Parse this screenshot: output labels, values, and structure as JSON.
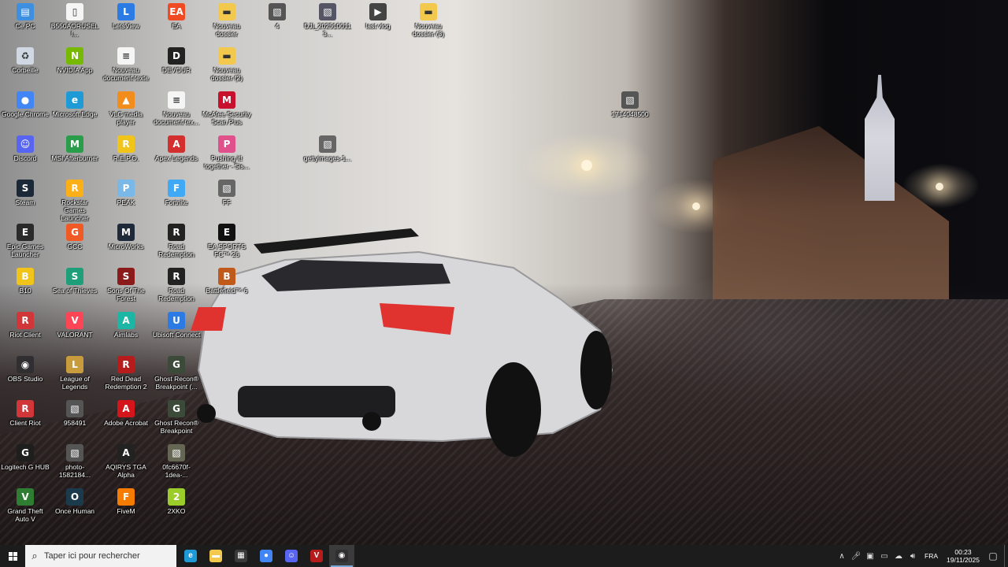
{
  "desktop": {
    "icons": [
      {
        "label": "Ce PC",
        "icon": "computer-icon",
        "color": "#3d8fe0"
      },
      {
        "label": "B550AORUSELI...",
        "icon": "document-icon",
        "color": "#f5f5f5"
      },
      {
        "label": "LetsView",
        "icon": "letsview-icon",
        "color": "#2c7be5"
      },
      {
        "label": "EA",
        "icon": "ea-icon",
        "color": "#f04a23"
      },
      {
        "label": "Nouveau dossier",
        "icon": "folder-icon",
        "color": "#f2c94c"
      },
      {
        "label": "4",
        "icon": "image-icon",
        "color": "#555"
      },
      {
        "label": "DJI_2025100113...",
        "icon": "image-icon",
        "color": "#556"
      },
      {
        "label": "last vlog",
        "icon": "video-icon",
        "color": "#444"
      },
      {
        "label": "Nouveau dossier (3)",
        "icon": "folder-icon",
        "color": "#f2c94c"
      },
      {
        "label": "Corbeille",
        "icon": "recycle-bin-icon",
        "color": "#cfd8e3"
      },
      {
        "label": "NVIDIA App",
        "icon": "nvidia-icon",
        "color": "#76b900"
      },
      {
        "label": "Nouveau document texte",
        "icon": "text-file-icon",
        "color": "#f5f5f5"
      },
      {
        "label": "DEVOUR",
        "icon": "devour-icon",
        "color": "#222"
      },
      {
        "label": "Nouveau dossier (2)",
        "icon": "folder-icon",
        "color": "#f2c94c"
      },
      {
        "label": "Google Chrome",
        "icon": "chrome-icon",
        "color": "#4285f4"
      },
      {
        "label": "Microsoft Edge",
        "icon": "edge-icon",
        "color": "#1e9bd7"
      },
      {
        "label": "VLC media player",
        "icon": "vlc-icon",
        "color": "#f28c1a"
      },
      {
        "label": "Nouveau document tex...",
        "icon": "text-file-icon",
        "color": "#f5f5f5"
      },
      {
        "label": "McAfee Security Scan Plus",
        "icon": "mcafee-icon",
        "color": "#c8102e"
      },
      {
        "label": "1714048500",
        "icon": "image-icon",
        "color": "#555"
      },
      {
        "label": "Discord",
        "icon": "discord-icon",
        "color": "#5865f2"
      },
      {
        "label": "MSI Afterburner",
        "icon": "msi-afterburner-icon",
        "color": "#2a9d4a"
      },
      {
        "label": "R.E.P.O.",
        "icon": "repo-icon",
        "color": "#f0c419"
      },
      {
        "label": "Apex Legends",
        "icon": "apex-icon",
        "color": "#d32f2f"
      },
      {
        "label": "Pushing it! together - Sis...",
        "icon": "app-icon",
        "color": "#e0508a"
      },
      {
        "label": "gettyimages-1...",
        "icon": "image-icon",
        "color": "#666"
      },
      {
        "label": "Steam",
        "icon": "steam-icon",
        "color": "#1b2838"
      },
      {
        "label": "Rockstar Games Launcher",
        "icon": "rockstar-icon",
        "color": "#fcaf17"
      },
      {
        "label": "PEAK",
        "icon": "peak-icon",
        "color": "#7ab8e8"
      },
      {
        "label": "Fortnite",
        "icon": "fortnite-icon",
        "color": "#3fa9f5"
      },
      {
        "label": "FF",
        "icon": "image-icon",
        "color": "#666"
      },
      {
        "label": "Epic Games Launcher",
        "icon": "epic-icon",
        "color": "#2a2a2a"
      },
      {
        "label": "GCC",
        "icon": "gcc-icon",
        "color": "#f15a24"
      },
      {
        "label": "MicroWorks",
        "icon": "microworks-icon",
        "color": "#1e2a3a"
      },
      {
        "label": "Road Redemption",
        "icon": "road-redemption-icon",
        "color": "#222"
      },
      {
        "label": "EA SPORTS FC™ 26",
        "icon": "ea-fc-icon",
        "color": "#111"
      },
      {
        "label": "B10",
        "icon": "app-icon",
        "color": "#f0c419"
      },
      {
        "label": "Sea of Thieves",
        "icon": "sea-of-thieves-icon",
        "color": "#1f9e7a"
      },
      {
        "label": "Sons Of The Forest",
        "icon": "sons-forest-icon",
        "color": "#8b1a1a"
      },
      {
        "label": "Road Redemption",
        "icon": "road-redemption-icon",
        "color": "#222"
      },
      {
        "label": "Battlefield™ 6",
        "icon": "battlefield-icon",
        "color": "#c05a1a"
      },
      {
        "label": "Riot Client",
        "icon": "riot-icon",
        "color": "#d13639"
      },
      {
        "label": "VALORANT",
        "icon": "valorant-icon",
        "color": "#fd4556"
      },
      {
        "label": "Aimlabs",
        "icon": "aimlabs-icon",
        "color": "#1db5a3"
      },
      {
        "label": "Ubisoft Connect",
        "icon": "ubisoft-icon",
        "color": "#2c7be5"
      },
      {
        "label": "OBS Studio",
        "icon": "obs-icon",
        "color": "#302e31"
      },
      {
        "label": "League of Legends",
        "icon": "lol-icon",
        "color": "#c89b3c"
      },
      {
        "label": "Red Dead Redemption 2",
        "icon": "rdr2-icon",
        "color": "#b71c1c"
      },
      {
        "label": "Ghost Recon® Breakpoint (...",
        "icon": "ghost-recon-icon",
        "color": "#3c4a3a"
      },
      {
        "label": "Client Riot",
        "icon": "riot-icon",
        "color": "#d13639"
      },
      {
        "label": "958491",
        "icon": "image-icon",
        "color": "#555"
      },
      {
        "label": "Adobe Acrobat",
        "icon": "acrobat-icon",
        "color": "#d4151b"
      },
      {
        "label": "Ghost Recon® Breakpoint",
        "icon": "ghost-recon-icon",
        "color": "#3c4a3a"
      },
      {
        "label": "Logitech G HUB",
        "icon": "logitech-icon",
        "color": "#1e1e1e"
      },
      {
        "label": "photo-1582184...",
        "icon": "image-icon",
        "color": "#555"
      },
      {
        "label": "AQIRYS TGA Alpha",
        "icon": "aqirys-icon",
        "color": "#222"
      },
      {
        "label": "0fc6670f-1dea-...",
        "icon": "image-icon",
        "color": "#665"
      },
      {
        "label": "Grand Theft Auto V",
        "icon": "gta-icon",
        "color": "#2e7d32"
      },
      {
        "label": "Once Human",
        "icon": "once-human-icon",
        "color": "#1b3a4b"
      },
      {
        "label": "FiveM",
        "icon": "fivem-icon",
        "color": "#f57c00"
      },
      {
        "label": "2XKO",
        "icon": "2xko-icon",
        "color": "#9ccc2a"
      }
    ]
  },
  "taskbar": {
    "start": {
      "icon": "windows-start-icon"
    },
    "search": {
      "placeholder": "Taper ici pour rechercher",
      "icon": "search-icon"
    },
    "apps": [
      {
        "name": "edge",
        "icon": "edge-icon",
        "color": "#1e9bd7",
        "active": false
      },
      {
        "name": "file-explorer",
        "icon": "folder-icon",
        "color": "#f2c94c",
        "active": false
      },
      {
        "name": "store",
        "icon": "store-icon",
        "color": "#3a3a3a",
        "active": false
      },
      {
        "name": "chrome",
        "icon": "chrome-icon",
        "color": "#4285f4",
        "active": false
      },
      {
        "name": "discord",
        "icon": "discord-icon",
        "color": "#5865f2",
        "active": false
      },
      {
        "name": "voice-meeter",
        "icon": "voicemeeter-icon",
        "color": "#b71c1c",
        "active": false
      },
      {
        "name": "obs",
        "icon": "obs-icon",
        "color": "#302e31",
        "active": true
      }
    ],
    "tray": {
      "language": "FRA",
      "time": "00:23",
      "date": "19/11/2025"
    }
  }
}
